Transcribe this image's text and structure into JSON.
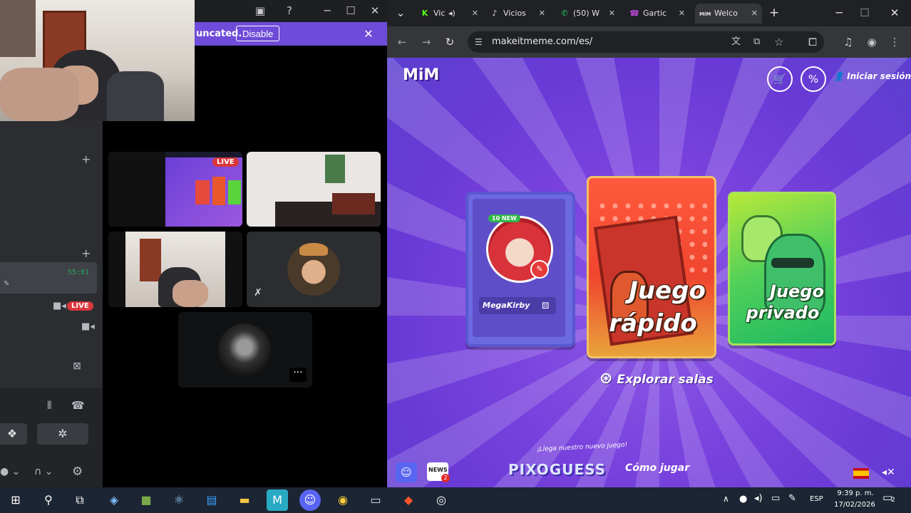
{
  "discord": {
    "notice": {
      "text": "uncated.",
      "button": "Disable"
    },
    "sidebar": {
      "timer": "55:01",
      "live_badge": "LIVE"
    },
    "tiles": {
      "live_badge": "LIVE"
    }
  },
  "browser": {
    "tabs": [
      {
        "icon": "K",
        "label": "Vic",
        "color": "#53fc18"
      },
      {
        "icon": "♪",
        "label": "Vicios",
        "color": "#ffffff"
      },
      {
        "icon": "✆",
        "label": "(50) W",
        "color": "#25d366"
      },
      {
        "icon": "☎",
        "label": "Gartic",
        "color": "#c04be0"
      },
      {
        "icon": "MiM",
        "label": "Welco",
        "color": "#ffffff",
        "active": true
      }
    ],
    "url": "makeitmeme.com/es/"
  },
  "page": {
    "logo": "MiM",
    "login": "Iniciar sesión",
    "profile": {
      "badge": "10 NEW",
      "username": "MegaKirby"
    },
    "quick_game": {
      "line1": "Juego",
      "line2": "rápido"
    },
    "private_game": {
      "line1": "Juego",
      "line2": "privado"
    },
    "explore": "Explorar salas",
    "promo": "¡Llega nuestro nuevo juego!",
    "pixoguess": "PIXOGUESS",
    "how_to_play": "Cómo jugar",
    "news_badge": "2",
    "news_label": "NEWS"
  },
  "taskbar": {
    "lang": "ESP",
    "time": "9:39 p. m.",
    "date": "17/02/2026",
    "notif": "2"
  },
  "colors": {
    "accent": "#6e4bd8",
    "live": "#da373c",
    "browser_bg": "#202124"
  }
}
